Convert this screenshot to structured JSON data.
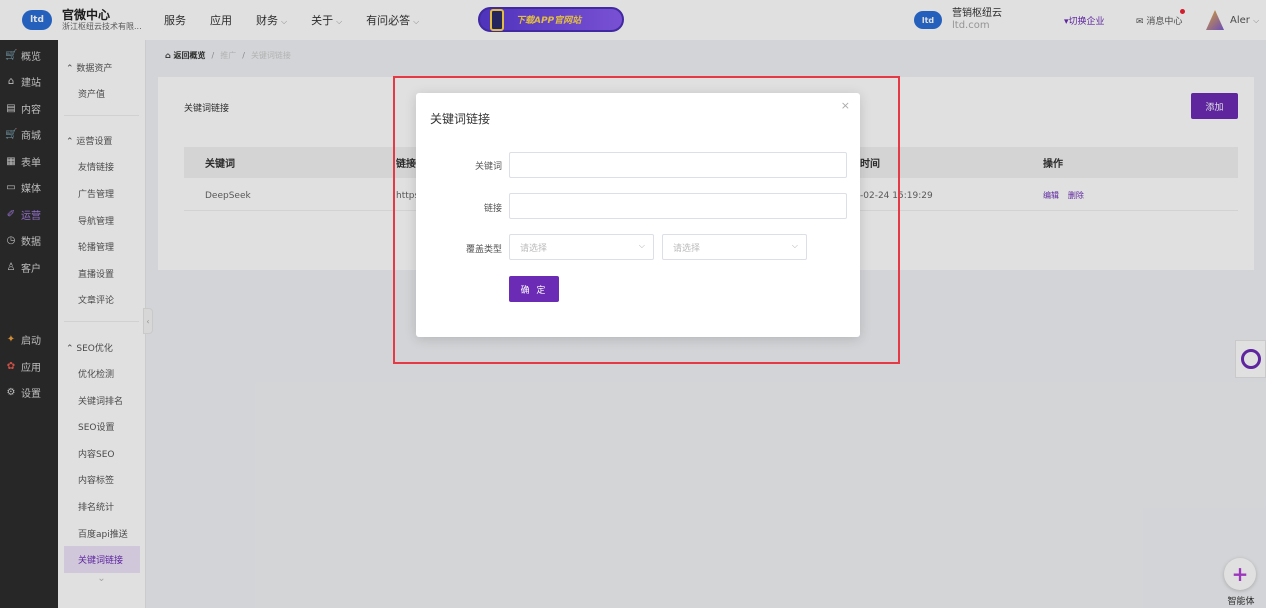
{
  "brand": {
    "logo": "ltd",
    "title": "官微中心",
    "subtitle": "浙江枢纽云技术有限..."
  },
  "topnav": [
    {
      "label": "服务",
      "has_caret": false
    },
    {
      "label": "应用",
      "has_caret": false
    },
    {
      "label": "财务",
      "has_caret": true
    },
    {
      "label": "关于",
      "has_caret": true
    },
    {
      "label": "有问必答",
      "has_caret": true
    }
  ],
  "promo": {
    "label": "下载APP官网站"
  },
  "header_right": {
    "tenant_logo": "ltd",
    "tenant_name": "营销枢纽云",
    "tenant_domain": "ltd.com",
    "switch_label": "▾切换企业",
    "messages_label": "✉ 消息中心",
    "user_name": "Aler"
  },
  "sidebar": [
    {
      "icon": "🛒",
      "label": "概览"
    },
    {
      "icon": "⌂",
      "label": "建站"
    },
    {
      "icon": "▤",
      "label": "内容"
    },
    {
      "icon": "🛒",
      "label": "商城"
    },
    {
      "icon": "▦",
      "label": "表单"
    },
    {
      "icon": "▭",
      "label": "媒体"
    },
    {
      "icon": "✐",
      "label": "运营",
      "active": true
    },
    {
      "icon": "◷",
      "label": "数据"
    },
    {
      "icon": "♙",
      "label": "客户"
    }
  ],
  "sidebar_bottom": [
    {
      "icon": "✦",
      "label": "启动"
    },
    {
      "icon": "✿",
      "label": "应用"
    },
    {
      "icon": "⚙",
      "label": "设置"
    }
  ],
  "submenu": {
    "group1": {
      "title": "⌃ 数据资产",
      "items": [
        "资产值"
      ]
    },
    "group2": {
      "title": "⌃ 运营设置",
      "items": [
        "友情链接",
        "广告管理",
        "导航管理",
        "轮播管理",
        "直播设置",
        "文章评论"
      ]
    },
    "group3": {
      "title": "⌃ SEO优化",
      "items": [
        "优化检测",
        "关键词排名",
        "SEO设置",
        "内容SEO",
        "内容标签",
        "排名统计",
        "百度api推送",
        "关键词链接"
      ]
    },
    "active_item": "关键词链接",
    "more_chevron": "⌄"
  },
  "breadcrumb": {
    "home": "返回概览",
    "level1": "推广",
    "level2": "关键词链接"
  },
  "panel": {
    "title": "关键词链接",
    "add_button": "添加",
    "columns": [
      "关键词",
      "链接",
      "时间",
      "操作"
    ],
    "rows": [
      {
        "keyword": "DeepSeek",
        "link": "https",
        "time": "-02-24 15:19:29",
        "edit": "编辑",
        "delete": "删除"
      }
    ]
  },
  "modal": {
    "title": "关键词链接",
    "close": "×",
    "keyword_label": "关键词",
    "keyword_value": "",
    "link_label": "链接",
    "link_value": "",
    "cover_label": "覆盖类型",
    "select1_placeholder": "请选择",
    "select2_placeholder": "请选择",
    "confirm": "确 定"
  },
  "float_widgets": {
    "ai_label": "智能体"
  },
  "colors": {
    "accent": "#6b2bb5",
    "sidebar_bg": "#2d2d2d",
    "highlight": "#e63946"
  }
}
